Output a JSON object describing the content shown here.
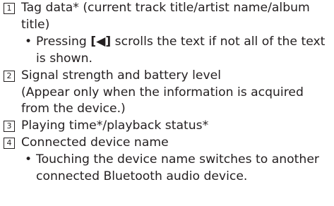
{
  "items": [
    {
      "number": "1",
      "text": "Tag data* (current track title/artist name/album title)",
      "bullet": {
        "prefix": "Pressing ",
        "button": "[◀]",
        "suffix": " scrolls the text if not all of the text is shown."
      }
    },
    {
      "number": "2",
      "text": "Signal strength and battery level",
      "note": "(Appear only when the information is acquired from the device.)"
    },
    {
      "number": "3",
      "text": "Playing time*/playback status*"
    },
    {
      "number": "4",
      "text": "Connected device name",
      "bullet_text": "Touching the device name switches to another connected Bluetooth audio device."
    }
  ]
}
